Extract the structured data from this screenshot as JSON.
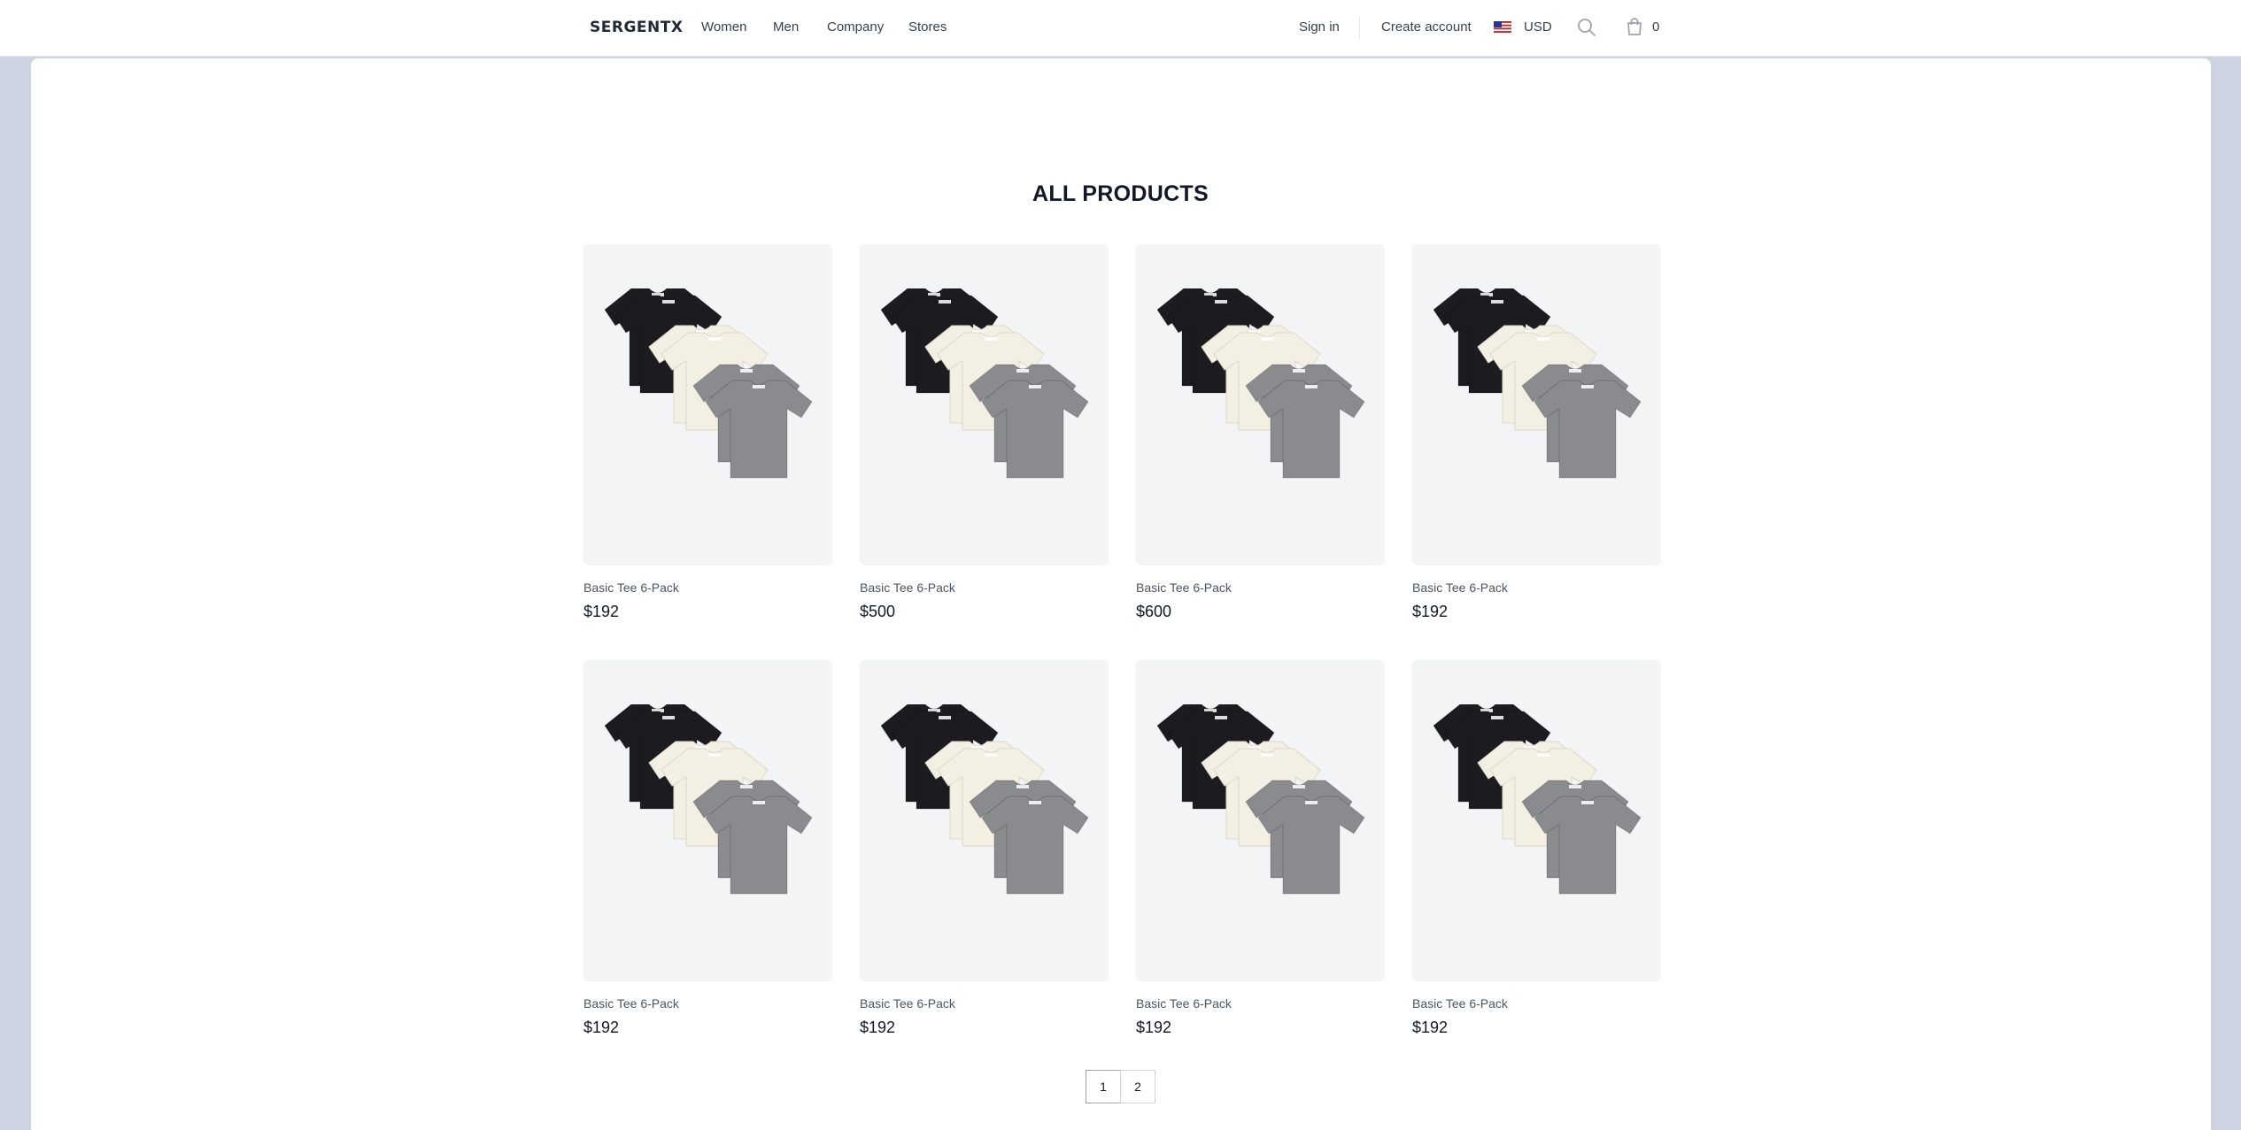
{
  "header": {
    "logo": "SERGENTX",
    "nav": [
      "Women",
      "Men",
      "Company",
      "Stores"
    ],
    "sign_in": "Sign in",
    "create_account": "Create account",
    "currency": "USD",
    "cart_count": "0",
    "icons": [
      "us-flag-icon",
      "search-icon",
      "shopping-bag-icon"
    ]
  },
  "main": {
    "title": "ALL PRODUCTS",
    "products": [
      {
        "name": "Basic Tee 6-Pack",
        "price": "$192"
      },
      {
        "name": "Basic Tee 6-Pack",
        "price": "$500"
      },
      {
        "name": "Basic Tee 6-Pack",
        "price": "$600"
      },
      {
        "name": "Basic Tee 6-Pack",
        "price": "$192"
      },
      {
        "name": "Basic Tee 6-Pack",
        "price": "$192"
      },
      {
        "name": "Basic Tee 6-Pack",
        "price": "$192"
      },
      {
        "name": "Basic Tee 6-Pack",
        "price": "$192"
      },
      {
        "name": "Basic Tee 6-Pack",
        "price": "$192"
      }
    ],
    "pagination": [
      "1",
      "2"
    ],
    "current_page": "1"
  },
  "colors": {
    "page_background": "#cdd3e0",
    "card_background": "#f3f4f6",
    "tee_black": "#1b1b20",
    "tee_cream": "#f3efe2",
    "tee_gray": "#8a8b8e"
  }
}
